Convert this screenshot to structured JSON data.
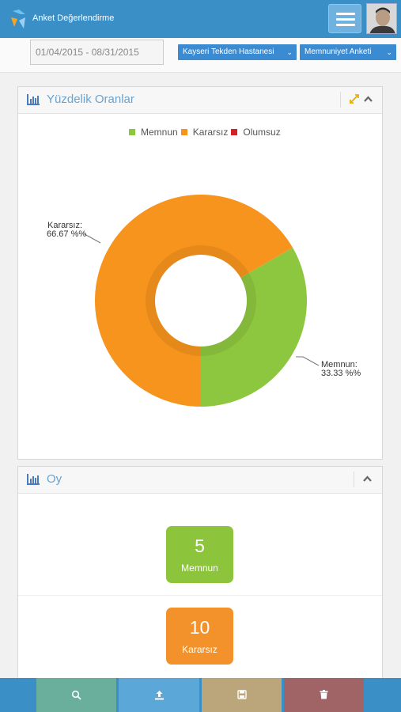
{
  "header": {
    "app_title": "Anket Değerlendirme"
  },
  "filters": {
    "date_range": "01/04/2015 - 08/31/2015",
    "hospital": "Kayseri Tekden Hastanesi",
    "survey": "Memnuniyet Anketi"
  },
  "percent_panel": {
    "title": "Yüzdelik Oranlar",
    "legend": [
      {
        "label": "Memnun",
        "color": "#8dc63f"
      },
      {
        "label": "Kararsız",
        "color": "#f7941d"
      },
      {
        "label": "Olumsuz",
        "color": "#d62027"
      }
    ],
    "labels": {
      "kararsiz_name": "Kararsız:",
      "kararsiz_value": "66.67 %%",
      "memnun_name": "Memnun:",
      "memnun_value": "33.33 %%"
    }
  },
  "chart_data": {
    "type": "pie",
    "categories": [
      "Memnun",
      "Kararsız",
      "Olumsuz"
    ],
    "values": [
      33.33,
      66.67,
      0
    ],
    "colors": [
      "#8dc63f",
      "#f7941d",
      "#d62027"
    ],
    "legend": "top-center",
    "donut": true
  },
  "votes_panel": {
    "title": "Oy",
    "items": [
      {
        "count": "5",
        "label": "Memnun",
        "color": "#8cc43c"
      },
      {
        "count": "10",
        "label": "Kararsız",
        "color": "#f3922b"
      }
    ]
  },
  "bottom_bar": {
    "search_icon": "search-icon",
    "upload_icon": "upload-icon",
    "save_icon": "save-icon",
    "delete_icon": "trash-icon"
  }
}
